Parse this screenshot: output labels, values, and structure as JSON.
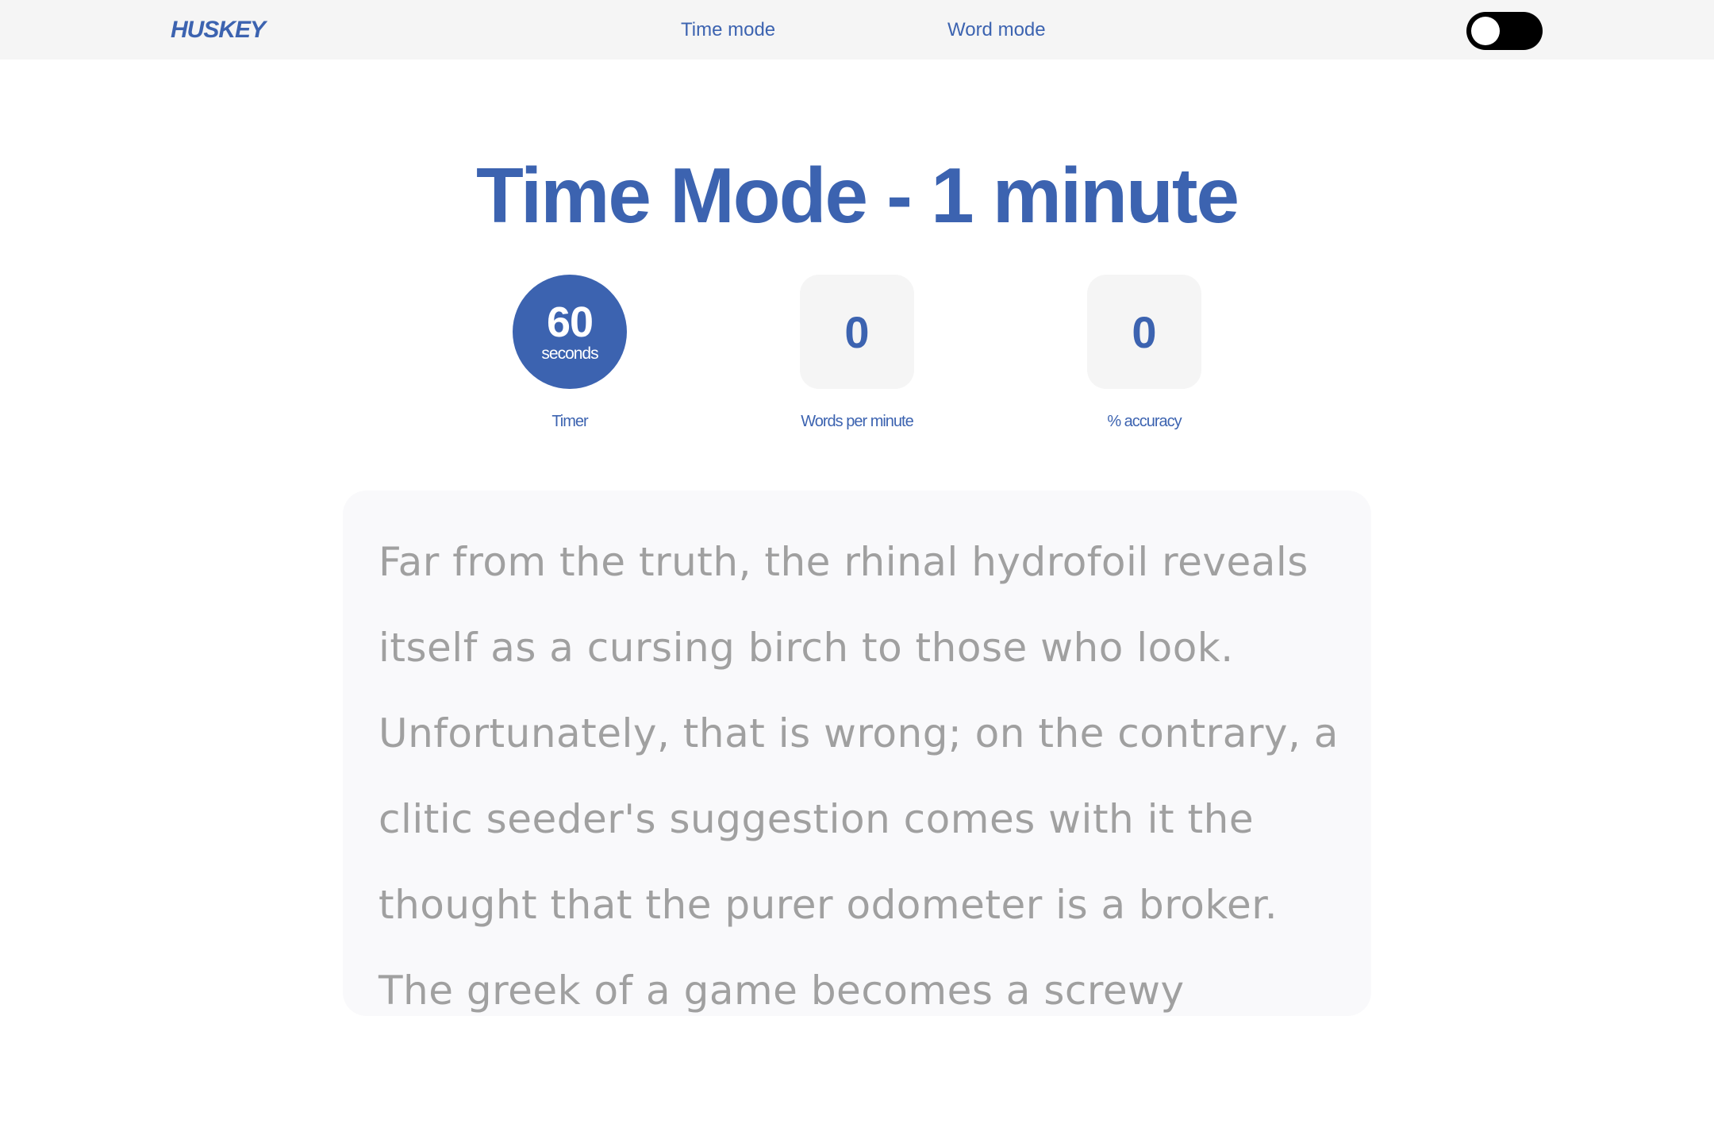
{
  "nav": {
    "logo": "HUSKEY",
    "links": [
      "Time mode",
      "Word mode"
    ],
    "theme_toggle": "off"
  },
  "main": {
    "title": "Time Mode - 1 minute",
    "stats": {
      "timer": {
        "value": "60",
        "unit": "seconds",
        "label": "Timer"
      },
      "wpm": {
        "value": "0",
        "label": "Words per minute"
      },
      "accuracy": {
        "value": "0",
        "label": "% accuracy"
      }
    },
    "text": "Far from the truth, the rhinal hydrofoil reveals itself as a cursing birch to those who look. Unfortunately, that is wrong; on the contrary, a clitic seeder's suggestion comes with it the thought that the purer odometer is a broker. The greek of a game becomes a screwy"
  },
  "colors": {
    "accent": "#3c63b0",
    "nav_bg": "#f5f5f5",
    "card_bg": "#f9f9fb",
    "text_muted": "#a0a0a0"
  }
}
